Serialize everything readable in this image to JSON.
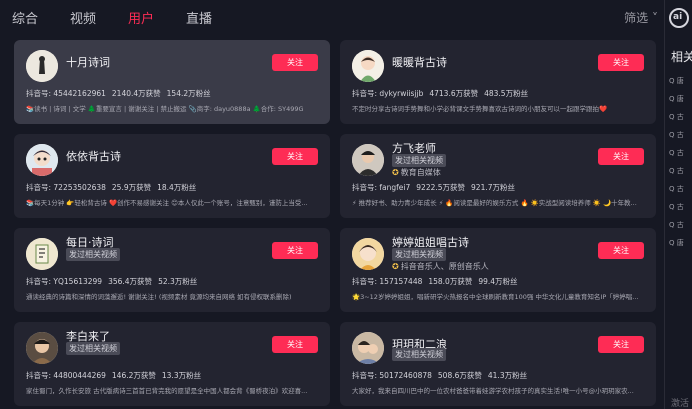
{
  "tabs": [
    {
      "label": "综合"
    },
    {
      "label": "视频"
    },
    {
      "label": "用户"
    },
    {
      "label": "直播"
    }
  ],
  "filter_label": "筛选 ˅",
  "sidebar": {
    "title": "相关",
    "items": [
      "Q 唐",
      "Q 唐",
      "Q 古",
      "Q 古",
      "Q 古",
      "Q 古",
      "Q 古",
      "Q 古",
      "Q 古",
      "Q 唐"
    ],
    "footer": "激活 W"
  },
  "cards": [
    {
      "name": "十月诗词",
      "tagline": "",
      "badge": "",
      "verified": "",
      "follow": "关注",
      "id": "抖音号: 45442162961",
      "likes": "2140.4万获赞",
      "fans": "154.2万粉丝",
      "bio": "📚读书 | 诗词 | 文学 🌲重要宣言 | 谢谢关注 | 禁止搬运 📎商字: dayu0888a 🌲合作: SY499G"
    },
    {
      "name": "暖暖背古诗",
      "tagline": "",
      "badge": "",
      "verified": "",
      "follow": "关注",
      "id": "抖音号: dykyrwiisjjb",
      "likes": "4713.6万获赞",
      "fans": "483.5万粉丝",
      "bio": "不定时分享古诗词手势舞和小学必背课文手势舞喜欢古诗词的小朋友可以一起跟学跟拍❤️"
    },
    {
      "name": "依依背古诗",
      "tagline": "",
      "badge": "",
      "verified": "",
      "follow": "关注",
      "id": "抖音号: 72253502638",
      "likes": "25.9万获赞",
      "fans": "18.4万粉丝",
      "bio": "📚每天1分钟 👉轻松背古诗 ❤️创作不易感谢关注 😊本人仅此一个账号，注意甄别，谨防上当受..."
    },
    {
      "name": "方飞老师",
      "tagline": "",
      "badge": "发过相关视频",
      "verified": "教育自媒体",
      "follow": "关注",
      "id": "抖音号: fangfei7",
      "likes": "9222.5万获赞",
      "fans": "921.7万粉丝",
      "bio": "⚡ 推荐好书、助力青少年成长 ⚡ 🔥阅读是最好的娱乐方式 🔥 ☀️实战型阅读培养师 ☀️ 🌙十年教..."
    },
    {
      "name": "每日·诗词",
      "tagline": "",
      "badge": "发过相关视频",
      "verified": "",
      "follow": "关注",
      "id": "抖音号: YQ15613299",
      "likes": "356.4万获赞",
      "fans": "52.3万粉丝",
      "bio": "通读经典的诗篇和深情的词藻邂逅! 谢谢关注! (视频素材 竟源均来自网络 如有侵权联系删除)"
    },
    {
      "name": "婷婷姐姐唱古诗",
      "tagline": "",
      "badge": "发过相关视频",
      "verified": "抖音音乐人、原创音乐人",
      "follow": "关注",
      "id": "抖音号: 157157448",
      "likes": "158.0万获赞",
      "fans": "99.4万粉丝",
      "bio": "🌟3~12岁婷婷姐姐，唱新研学火热报名中全球刷新教育100强 中华文化儿童教育知名IP「婷婷唱..."
    },
    {
      "name": "李白来了",
      "tagline": "",
      "badge": "发过相关视频",
      "verified": "",
      "follow": "关注",
      "id": "抖音号: 44800444269",
      "likes": "146.2万获赞",
      "fans": "13.3万粉丝",
      "bio": "家住蜀门，久作长安旅 古代版病诗三首首已背完我的愿望是全中国人都会背《蜀桥夜泊》欢迎喜..."
    },
    {
      "name": "玥玥和二浪",
      "tagline": "",
      "badge": "发过相关视频",
      "verified": "",
      "follow": "关注",
      "id": "抖音号: 50172460878",
      "likes": "508.6万获赞",
      "fans": "41.3万粉丝",
      "bio": "大家好，我来自四川巴中的一位农村爸爸带着娃游学农村孩子的真实生活!唯一小号@小玥玥家农..."
    }
  ]
}
